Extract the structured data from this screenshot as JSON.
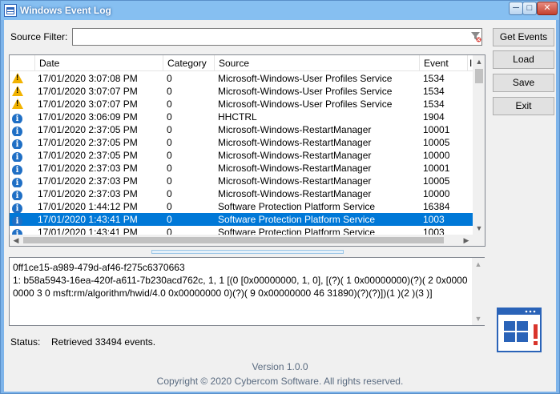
{
  "window": {
    "title": "Windows Event Log"
  },
  "filter": {
    "label": "Source Filter:",
    "value": "",
    "icon": "filter-clear-icon"
  },
  "buttons": {
    "get_events": "Get Events",
    "load": "Load",
    "save": "Save",
    "exit": "Exit"
  },
  "columns": {
    "date": "Date",
    "category": "Category",
    "source": "Source",
    "event": "Event",
    "more": "I"
  },
  "rows": [
    {
      "icon": "warning",
      "date": "17/01/2020 3:07:08 PM",
      "category": "0",
      "source": "Microsoft-Windows-User Profiles Service",
      "event": "1534",
      "more": ""
    },
    {
      "icon": "warning",
      "date": "17/01/2020 3:07:07 PM",
      "category": "0",
      "source": "Microsoft-Windows-User Profiles Service",
      "event": "1534",
      "more": ""
    },
    {
      "icon": "warning",
      "date": "17/01/2020 3:07:07 PM",
      "category": "0",
      "source": "Microsoft-Windows-User Profiles Service",
      "event": "1534",
      "more": ""
    },
    {
      "icon": "info",
      "date": "17/01/2020 3:06:09 PM",
      "category": "0",
      "source": "HHCTRL",
      "event": "1904",
      "more": ""
    },
    {
      "icon": "info",
      "date": "17/01/2020 2:37:05 PM",
      "category": "0",
      "source": "Microsoft-Windows-RestartManager",
      "event": "10001",
      "more": ""
    },
    {
      "icon": "info",
      "date": "17/01/2020 2:37:05 PM",
      "category": "0",
      "source": "Microsoft-Windows-RestartManager",
      "event": "10005",
      "more": ""
    },
    {
      "icon": "info",
      "date": "17/01/2020 2:37:05 PM",
      "category": "0",
      "source": "Microsoft-Windows-RestartManager",
      "event": "10000",
      "more": ""
    },
    {
      "icon": "info",
      "date": "17/01/2020 2:37:03 PM",
      "category": "0",
      "source": "Microsoft-Windows-RestartManager",
      "event": "10001",
      "more": ""
    },
    {
      "icon": "info",
      "date": "17/01/2020 2:37:03 PM",
      "category": "0",
      "source": "Microsoft-Windows-RestartManager",
      "event": "10005",
      "more": ""
    },
    {
      "icon": "info",
      "date": "17/01/2020 2:37:03 PM",
      "category": "0",
      "source": "Microsoft-Windows-RestartManager",
      "event": "10000",
      "more": ""
    },
    {
      "icon": "info",
      "date": "17/01/2020 1:44:12 PM",
      "category": "0",
      "source": "Software Protection Platform Service",
      "event": "16384",
      "more": ""
    },
    {
      "icon": "info",
      "date": "17/01/2020 1:43:41 PM",
      "category": "0",
      "source": "Software Protection Platform Service",
      "event": "1003",
      "more": "",
      "selected": true
    },
    {
      "icon": "info",
      "date": "17/01/2020 1:43:41 PM",
      "category": "0",
      "source": "Software Protection Platform Service",
      "event": "1003",
      "more": ""
    }
  ],
  "detail": {
    "text": "0ff1ce15-a989-479d-af46-f275c6370663\n1: b58a5943-16ea-420f-a611-7b230acd762c, 1, 1 [(0 [0x00000000, 1, 0], [(?)( 1 0x00000000)(?)( 2 0x00000000 3 0 msft:rm/algorithm/hwid/4.0 0x00000000 0)(?)( 9 0x00000000 46 31890)(?)(?)])(1 )(2 )(3 )]"
  },
  "status": {
    "label": "Status:",
    "text": "Retrieved 33494 events."
  },
  "footer": {
    "version": "Version 1.0.0",
    "copyright": "Copyright © 2020 Cybercom Software. All rights reserved."
  },
  "colors": {
    "titlebar": "#86bff1",
    "selection": "#0078d7",
    "warning": "#f2b300",
    "info": "#1f6fc5",
    "footer_text": "#5a6b80"
  }
}
